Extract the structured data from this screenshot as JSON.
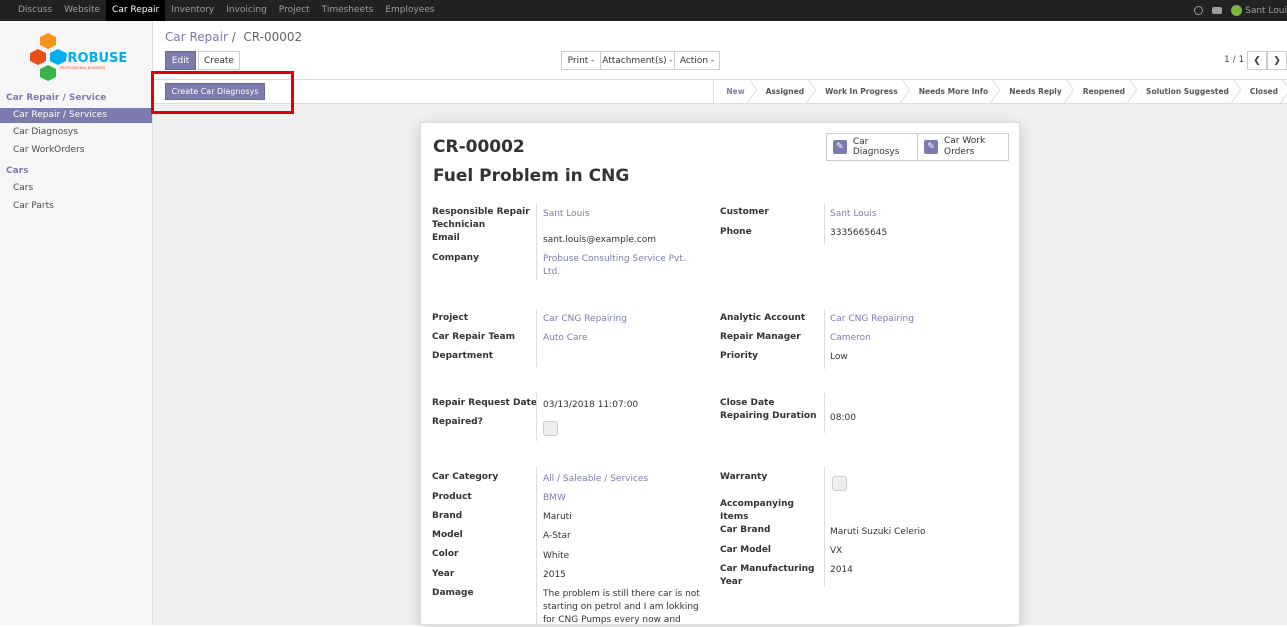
{
  "topbar": {
    "menu": [
      "Discuss",
      "Website",
      "Car Repair",
      "Inventory",
      "Invoicing",
      "Project",
      "Timesheets",
      "Employees"
    ],
    "active": "Car Repair",
    "user": "Sant Loui"
  },
  "logo": {
    "text": "PROBUSE",
    "tagline": "PROFESSIONAL BUSINESS"
  },
  "sidebar": {
    "section1": "Car Repair / Service",
    "items1": [
      "Car Repair / Services",
      "Car Diagnosys",
      "Car WorkOrders"
    ],
    "section2": "Cars",
    "items2": [
      "Cars",
      "Car Parts"
    ]
  },
  "breadcrumb": {
    "parent": "Car Repair",
    "separator": "/",
    "current": "CR-00002"
  },
  "buttons": {
    "edit": "Edit",
    "create": "Create",
    "print": "Print -",
    "attachments": "Attachment(s) -",
    "action": "Action -",
    "create_diag": "Create Car Diagnosys"
  },
  "pager": {
    "text": "1 / 1",
    "prev": "❮",
    "next": "❯"
  },
  "stages": [
    "New",
    "Assigned",
    "Work In Progress",
    "Needs More Info",
    "Needs Reply",
    "Reopened",
    "Solution Suggested",
    "Closed"
  ],
  "current_stage": "New",
  "sheet": {
    "ref": "CR-00002",
    "title": "Fuel Problem in CNG",
    "smart1": "Car Diagnosys",
    "smart2": "Car Work Orders",
    "left1": {
      "tech_l": "Responsible Repair Technician",
      "tech_v": "Sant Louis",
      "email_l": "Email",
      "email_v": "sant.louis@example.com",
      "company_l": "Company",
      "company_v": "Probuse Consulting Service Pvt. Ltd."
    },
    "right1": {
      "customer_l": "Customer",
      "customer_v": "Sant Louis",
      "phone_l": "Phone",
      "phone_v": "3335665645"
    },
    "left2": {
      "project_l": "Project",
      "project_v": "Car CNG Repairing",
      "team_l": "Car Repair Team",
      "team_v": "Auto Care",
      "dept_l": "Department"
    },
    "right2": {
      "analytic_l": "Analytic Account",
      "analytic_v": "Car CNG Repairing",
      "manager_l": "Repair Manager",
      "manager_v": "Cameron",
      "priority_l": "Priority",
      "priority_v": "Low"
    },
    "left3": {
      "date_l": "Repair Request Date",
      "date_v": "03/13/2018 11:07:00",
      "repaired_l": "Repaired?"
    },
    "right3": {
      "close_l": "Close Date",
      "duration_l": "Repairing Duration",
      "duration_v": "08:00"
    },
    "left4": {
      "cat_l": "Car Category",
      "cat_v": "All / Saleable / Services",
      "product_l": "Product",
      "product_v": "BMW",
      "brand_l": "Brand",
      "brand_v": "Maruti",
      "model_l": "Model",
      "model_v": "A-Star",
      "color_l": "Color",
      "color_v": "White",
      "year_l": "Year",
      "year_v": "2015",
      "damage_l": "Damage",
      "damage_v": "The problem is still there car is not starting on petrol and I am lokking for CNG Pumps every now and"
    },
    "right4": {
      "warranty_l": "Warranty",
      "acc_l": "Accompanying Items",
      "carbrand_l": "Car Brand",
      "carbrand_v": "Maruti Suzuki Celerio",
      "carmodel_l": "Car Model",
      "carmodel_v": "VX",
      "manuf_l": "Car Manufacturing Year",
      "manuf_v": "2014"
    }
  }
}
